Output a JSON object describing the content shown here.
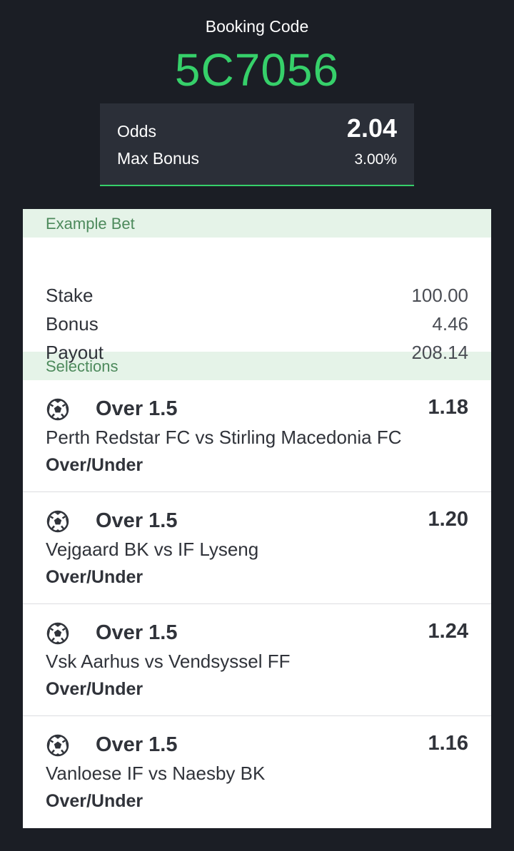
{
  "booking": {
    "label": "Booking Code",
    "code": "5C7056"
  },
  "summary": {
    "odds_label": "Odds",
    "odds_value": "2.04",
    "bonus_label": "Max Bonus",
    "bonus_value": "3.00%"
  },
  "example": {
    "title": "Example Bet",
    "rows": [
      {
        "label": "Stake",
        "value": "100.00"
      },
      {
        "label": "Bonus",
        "value": "4.46"
      },
      {
        "label": "Payout",
        "value": "208.14"
      }
    ]
  },
  "selections": {
    "title": "Selections",
    "icon": "soccer-ball-icon",
    "items": [
      {
        "market": "Over 1.5",
        "odds": "1.18",
        "match": "Perth Redstar FC vs Stirling Macedonia FC",
        "type": "Over/Under"
      },
      {
        "market": "Over 1.5",
        "odds": "1.20",
        "match": "Vejgaard BK vs IF Lyseng",
        "type": "Over/Under"
      },
      {
        "market": "Over 1.5",
        "odds": "1.24",
        "match": "Vsk Aarhus vs Vendsyssel FF",
        "type": "Over/Under"
      },
      {
        "market": "Over 1.5",
        "odds": "1.16",
        "match": "Vanloese IF vs Naesby BK",
        "type": "Over/Under"
      }
    ]
  },
  "colors": {
    "background": "#1b1e25",
    "accent": "#36d06a",
    "panel": "#2b2f38",
    "section_header_bg": "#e5f3e8",
    "section_header_text": "#4d8a5c"
  }
}
